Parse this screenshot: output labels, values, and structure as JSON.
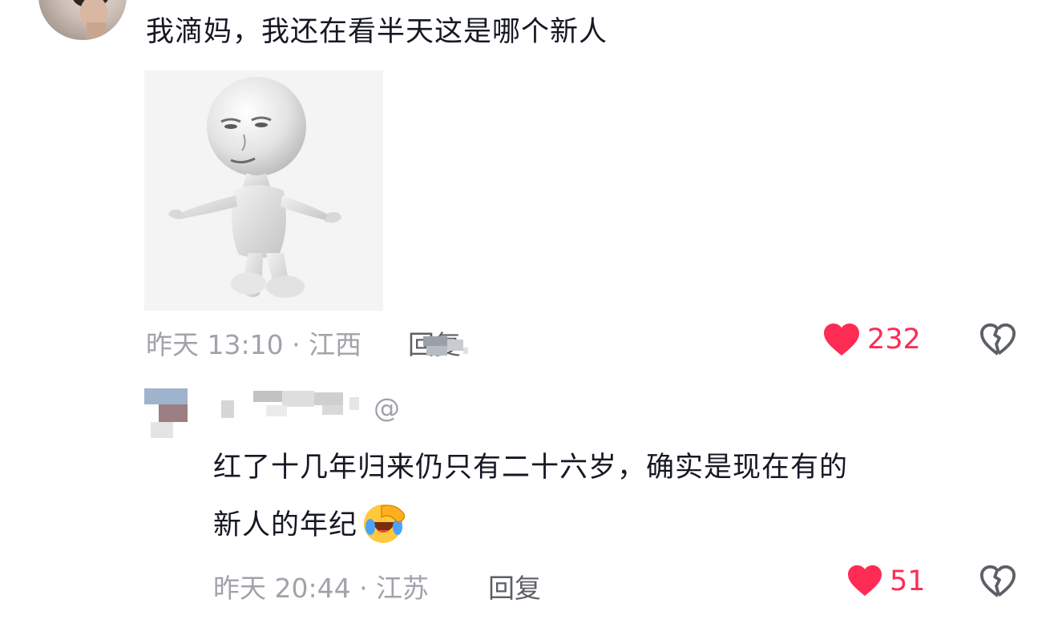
{
  "comment_main": {
    "text": "我滴妈，我还在看半天这是哪个新人",
    "meta": "昨天 13:10 · 江西",
    "reply_label": "回复",
    "like_count": "232",
    "sticker_icon": "shrugging-3d-figure-sticker"
  },
  "comment_reply": {
    "username_suffix": "@",
    "text_line1": "红了十几年归来仍只有二十六岁，确实是现在有的",
    "text_line2": "新人的年纪",
    "emoji_icon": "face-palm-laughing-emoji",
    "meta": "昨天 20:44 · 江苏",
    "reply_label": "回复",
    "like_count": "51"
  },
  "colors": {
    "like_red": "#fe2c55",
    "meta_gray": "#a1a3aa",
    "text_dark": "#161823",
    "icon_gray": "#5c5f66"
  }
}
